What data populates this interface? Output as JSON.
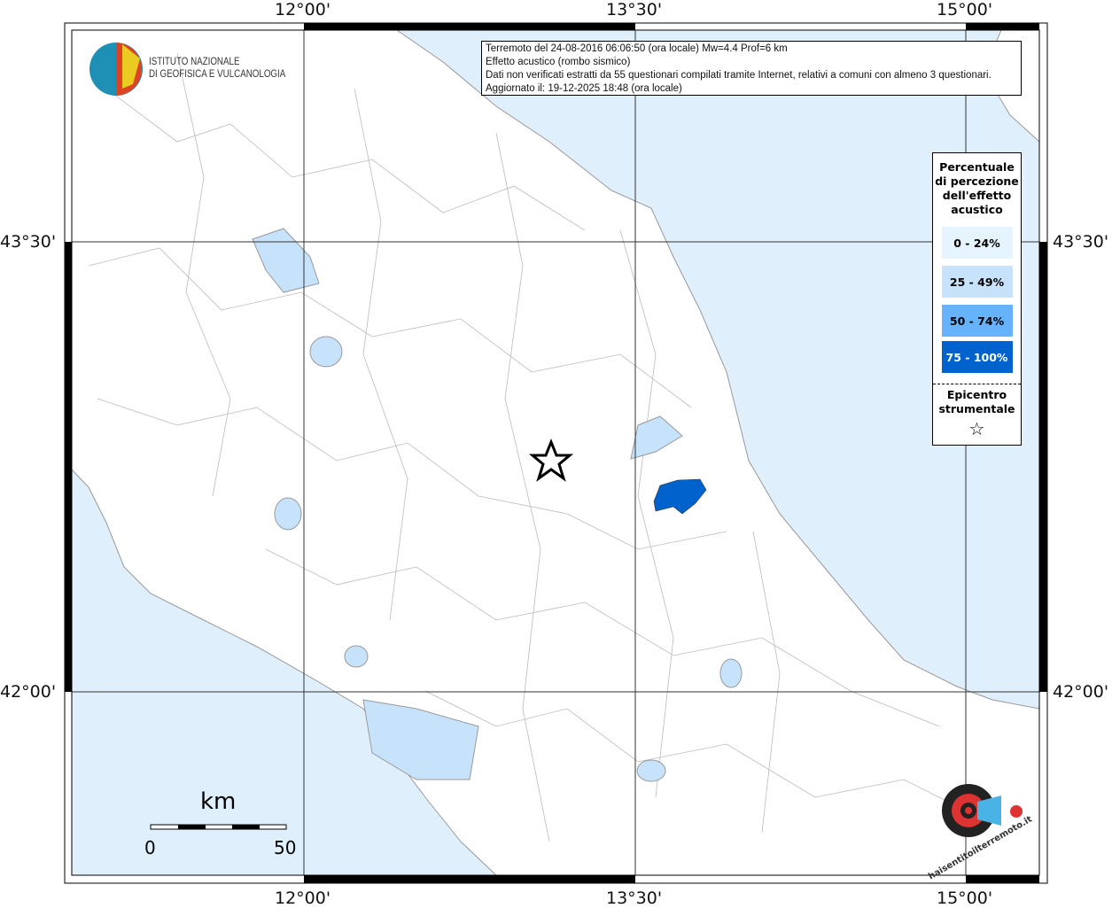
{
  "axes": {
    "lon_ticks": [
      "12°00'",
      "13°30'",
      "15°00'"
    ],
    "lat_ticks": [
      "43°30'",
      "42°00'"
    ]
  },
  "info": {
    "lines": [
      "Terremoto del 24-08-2016 06:06:50 (ora locale) Mw=4.4 Prof=6 km",
      "Effetto acustico (rombo sismico)",
      "Dati non verificati estratti da 55 questionari compilati tramite Internet, relativi a comuni con almeno 3 questionari.",
      "Aggiornato il: 19-12-2025 18:48 (ora locale)"
    ]
  },
  "legend": {
    "title": [
      "Percentuale",
      "di percezione",
      "dell'effetto",
      "acustico"
    ],
    "classes": [
      {
        "label": "0 - 24%",
        "color": "#e6f4fe",
        "text": "#000"
      },
      {
        "label": "25 - 49%",
        "color": "#c7e3fb",
        "text": "#000"
      },
      {
        "label": "50 - 74%",
        "color": "#66b3fb",
        "text": "#000"
      },
      {
        "label": "75 - 100%",
        "color": "#0062cc",
        "text": "#fff"
      }
    ],
    "epicenter": [
      "Epicentro",
      "strumentale"
    ]
  },
  "scale": {
    "unit": "km",
    "min": "0",
    "max": "50"
  },
  "logos": {
    "ingv": [
      "ISTITUTO NAZIONALE",
      "DI GEOFISICA E VULCANOLOGIA"
    ],
    "hsit": "haisentitoilterremoto.it"
  },
  "colors": {
    "sea": "#dff0fc",
    "felt_high": "#0062cc",
    "lake": "#c7e3fb"
  }
}
